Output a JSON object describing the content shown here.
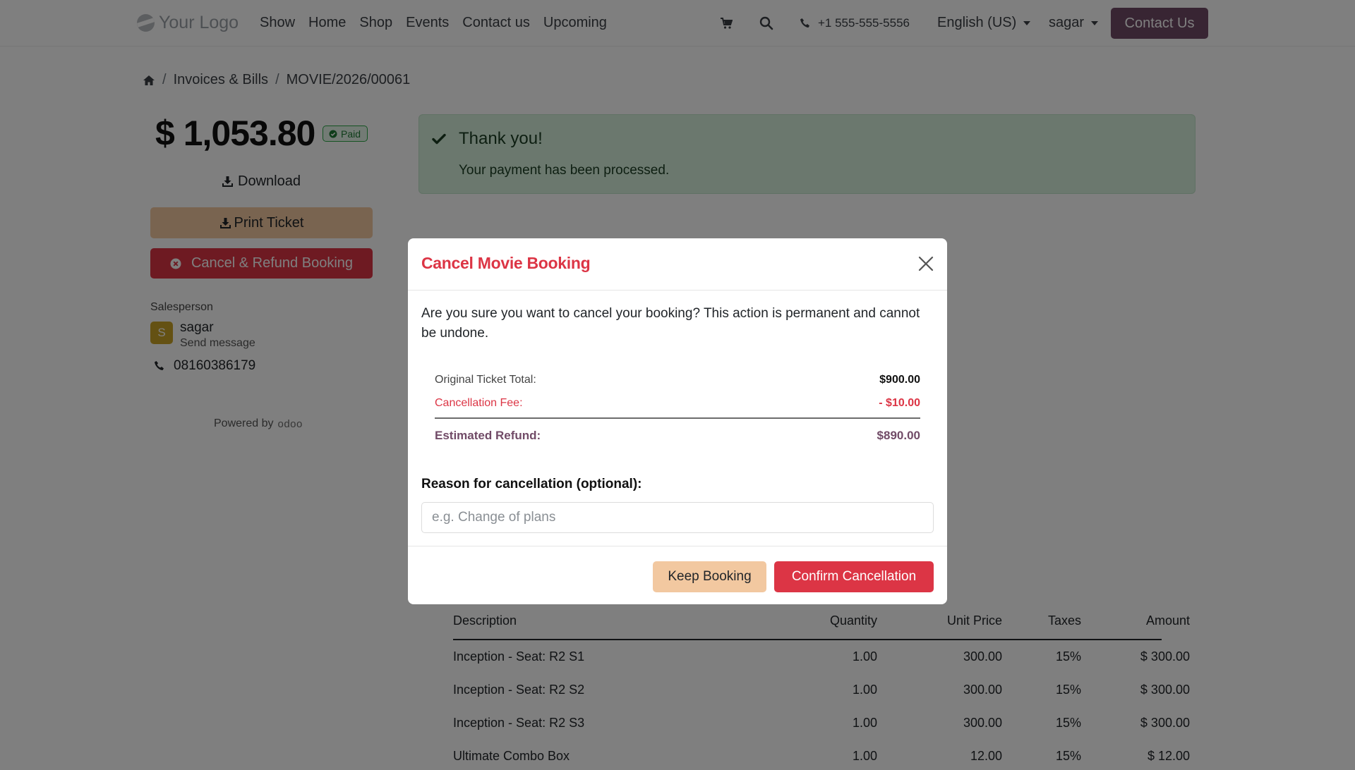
{
  "navbar": {
    "logo_text": "Your Logo",
    "links": [
      "Show",
      "Home",
      "Shop",
      "Events",
      "Contact us",
      "Upcoming"
    ],
    "phone": "+1 555-555-5556",
    "language": "English (US)",
    "user": "sagar",
    "cta": "Contact Us"
  },
  "breadcrumb": {
    "section": "Invoices & Bills",
    "current": "MOVIE/2026/00061"
  },
  "invoice": {
    "amount": "$ 1,053.80",
    "status": "Paid",
    "download_label": "Download",
    "print_label": "Print Ticket",
    "cancel_label": "Cancel & Refund Booking"
  },
  "salesperson": {
    "label": "Salesperson",
    "initial": "S",
    "name": "sagar",
    "message_link": "Send message",
    "phone": "08160386179"
  },
  "powered_by": {
    "text": "Powered by",
    "brand": "odoo"
  },
  "alert": {
    "title": "Thank you!",
    "text": "Your payment has been processed."
  },
  "lines": {
    "headers": {
      "description": "Description",
      "quantity": "Quantity",
      "unit_price": "Unit Price",
      "taxes": "Taxes",
      "amount": "Amount"
    },
    "rows": [
      {
        "description": "Inception - Seat: R2 S1",
        "quantity": "1.00",
        "unit_price": "300.00",
        "taxes": "15%",
        "amount": "$ 300.00"
      },
      {
        "description": "Inception - Seat: R2 S2",
        "quantity": "1.00",
        "unit_price": "300.00",
        "taxes": "15%",
        "amount": "$ 300.00"
      },
      {
        "description": "Inception - Seat: R2 S3",
        "quantity": "1.00",
        "unit_price": "300.00",
        "taxes": "15%",
        "amount": "$ 300.00"
      },
      {
        "description": "Ultimate Combo Box",
        "quantity": "1.00",
        "unit_price": "12.00",
        "taxes": "15%",
        "amount": "$ 12.00"
      }
    ]
  },
  "modal": {
    "title": "Cancel Movie Booking",
    "body": "Are you sure you want to cancel your booking? This action is permanent and cannot be undone.",
    "summary": {
      "original_label": "Original Ticket Total:",
      "original_value": "$900.00",
      "fee_label": "Cancellation Fee:",
      "fee_value": "- $10.00",
      "refund_label": "Estimated Refund:",
      "refund_value": "$890.00"
    },
    "reason_label": "Reason for cancellation (optional):",
    "reason_placeholder": "e.g. Change of plans",
    "reason_value": "",
    "keep_label": "Keep Booking",
    "confirm_label": "Confirm Cancellation"
  },
  "colors": {
    "brand": "#714b67",
    "danger": "#dc3545",
    "warning_soft": "#f2c8a0",
    "success_bg": "#d6f0dc"
  }
}
